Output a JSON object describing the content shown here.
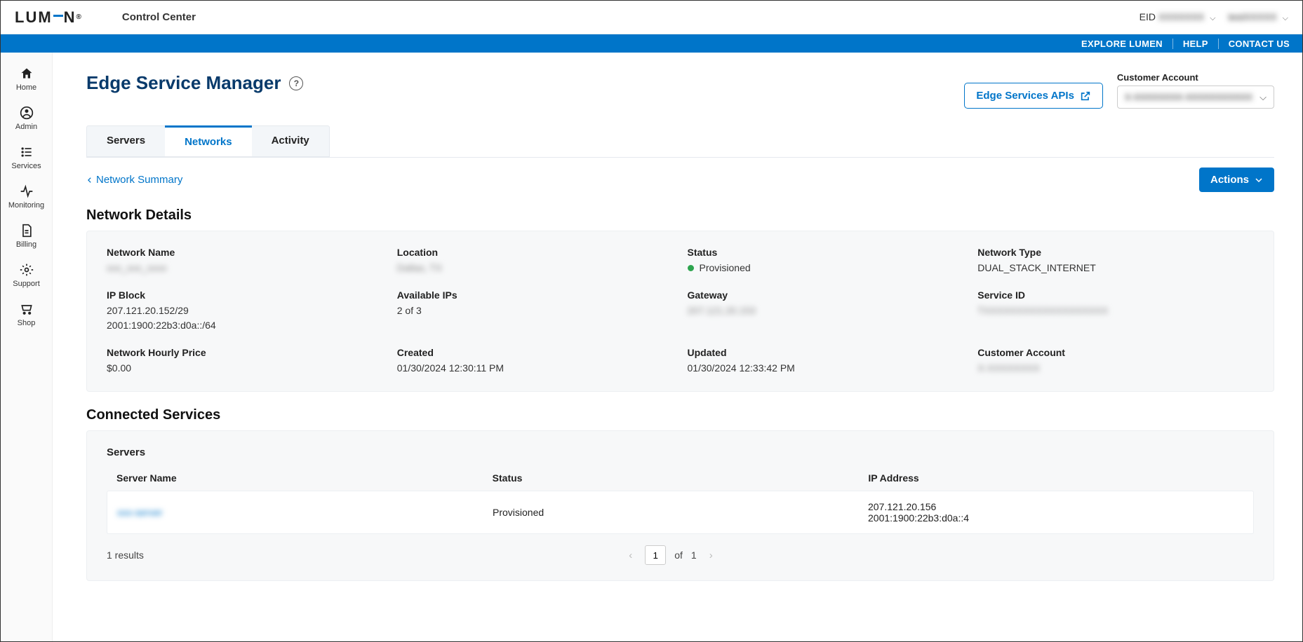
{
  "header": {
    "brand": "LUMEN",
    "appName": "Control Center",
    "eidLabel": "EID",
    "eidValue": "XXXXXXX",
    "userValue": "testXXXXX"
  },
  "blueBar": {
    "explore": "EXPLORE LUMEN",
    "help": "HELP",
    "contact": "CONTACT US"
  },
  "sidebar": {
    "items": [
      {
        "label": "Home"
      },
      {
        "label": "Admin"
      },
      {
        "label": "Services"
      },
      {
        "label": "Monitoring"
      },
      {
        "label": "Billing"
      },
      {
        "label": "Support"
      },
      {
        "label": "Shop"
      }
    ]
  },
  "page": {
    "title": "Edge Service Manager",
    "apisButton": "Edge Services APIs",
    "customerAccountLabel": "Customer Account",
    "customerAccountValue": "X-XXXXXXXX-XXXXXXXXXXX"
  },
  "tabs": {
    "servers": "Servers",
    "networks": "Networks",
    "activity": "Activity"
  },
  "crumb": {
    "back": "Network Summary"
  },
  "actionsBtn": "Actions",
  "detailsHeading": "Network Details",
  "details": {
    "networkNameLabel": "Network Name",
    "networkNameVal": "xxx_xxx_xxxx",
    "locationLabel": "Location",
    "locationVal": "Dallas, TX",
    "statusLabel": "Status",
    "statusVal": "Provisioned",
    "networkTypeLabel": "Network Type",
    "networkTypeVal": "DUAL_STACK_INTERNET",
    "ipBlockLabel": "IP Block",
    "ipBlockVal1": "207.121.20.152/29",
    "ipBlockVal2": "2001:1900:22b3:d0a::/64",
    "availIpsLabel": "Available IPs",
    "availIpsVal": "2 of 3",
    "gatewayLabel": "Gateway",
    "gatewayVal": "207.121.20.153",
    "serviceIdLabel": "Service ID",
    "serviceIdVal": "TXXXXXXXXXXXXXXXXXXX",
    "hourlyLabel": "Network Hourly Price",
    "hourlyVal": "$0.00",
    "createdLabel": "Created",
    "createdVal": "01/30/2024 12:30:11 PM",
    "updatedLabel": "Updated",
    "updatedVal": "01/30/2024 12:33:42 PM",
    "custAcctLabel": "Customer Account",
    "custAcctVal": "X-XXXXXXXX"
  },
  "connectedHeading": "Connected Services",
  "serversCard": {
    "title": "Servers",
    "colServer": "Server Name",
    "colStatus": "Status",
    "colIp": "IP Address",
    "rows": [
      {
        "name": "xxx-server",
        "status": "Provisioned",
        "ip1": "207.121.20.156",
        "ip2": "2001:1900:22b3:d0a::4"
      }
    ],
    "resultsText": "1 results",
    "page": "1",
    "ofText": "of",
    "totalPages": "1"
  }
}
